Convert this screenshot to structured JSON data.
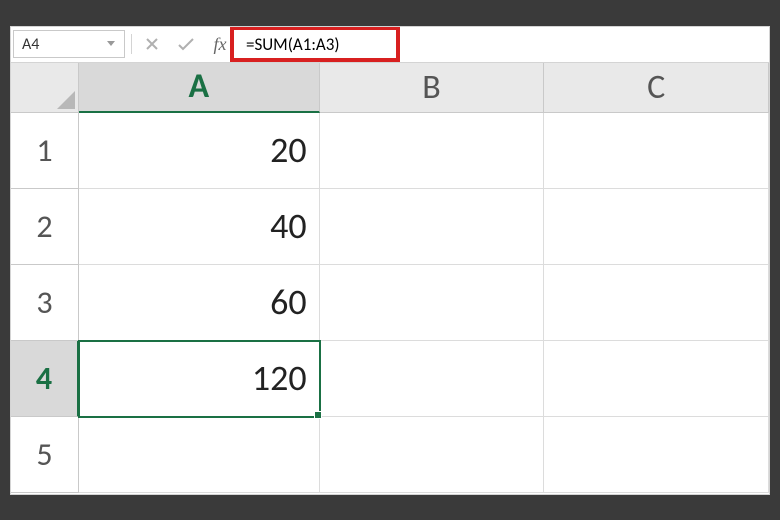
{
  "formula_bar": {
    "name_box": "A4",
    "fx_label": "fx",
    "formula": "=SUM(A1:A3)"
  },
  "columns": [
    {
      "id": "A",
      "label": "A",
      "active": true
    },
    {
      "id": "B",
      "label": "B",
      "active": false
    },
    {
      "id": "C",
      "label": "C",
      "active": false
    }
  ],
  "rows": [
    {
      "id": 1,
      "label": "1",
      "active": false
    },
    {
      "id": 2,
      "label": "2",
      "active": false
    },
    {
      "id": 3,
      "label": "3",
      "active": false
    },
    {
      "id": 4,
      "label": "4",
      "active": true
    },
    {
      "id": 5,
      "label": "5",
      "active": false
    }
  ],
  "cells": {
    "A1": "20",
    "A2": "40",
    "A3": "60",
    "A4": "120"
  },
  "selected_cell": "A4",
  "colors": {
    "selection_green": "#1a7044",
    "highlight_red": "#d82020"
  }
}
